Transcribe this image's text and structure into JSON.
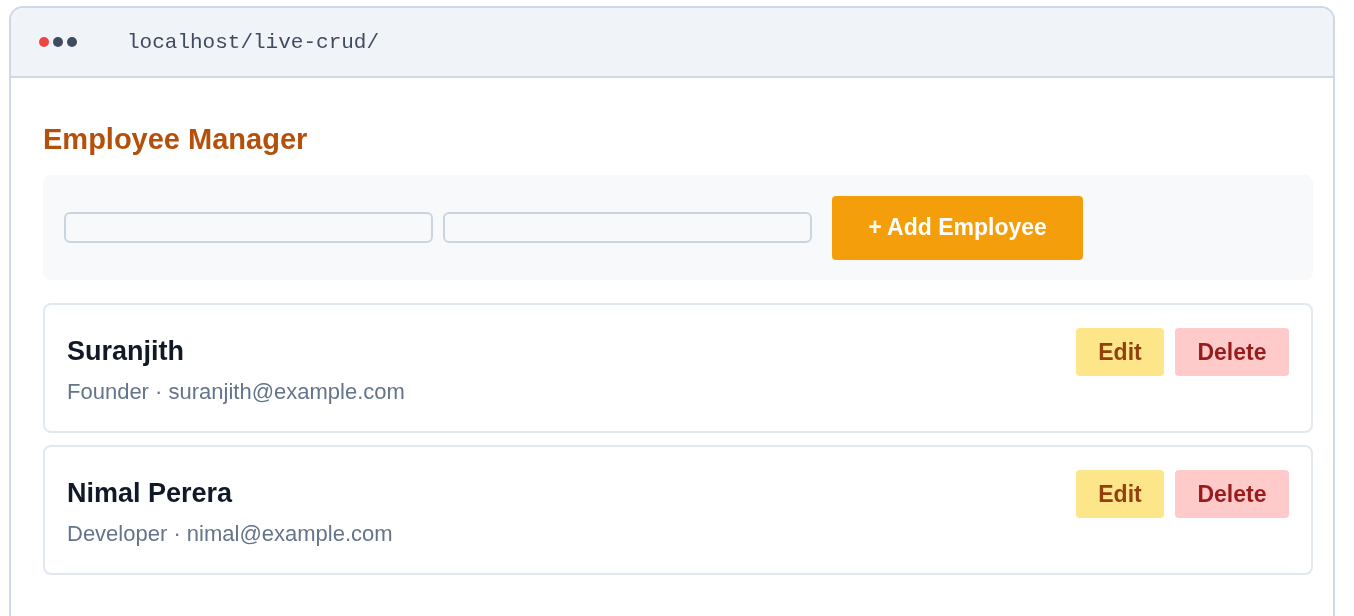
{
  "browser": {
    "url": "localhost/live-crud/"
  },
  "title": "Employee Manager",
  "form": {
    "button": "+ Add Employee"
  },
  "employees": [
    {
      "name": "Suranjith",
      "details": "Founder · suranjith@example.com",
      "edit": "Edit",
      "delete": "Delete"
    },
    {
      "name": "Nimal Perera",
      "details": "Developer · nimal@example.com",
      "edit": "Edit",
      "delete": "Delete"
    }
  ]
}
